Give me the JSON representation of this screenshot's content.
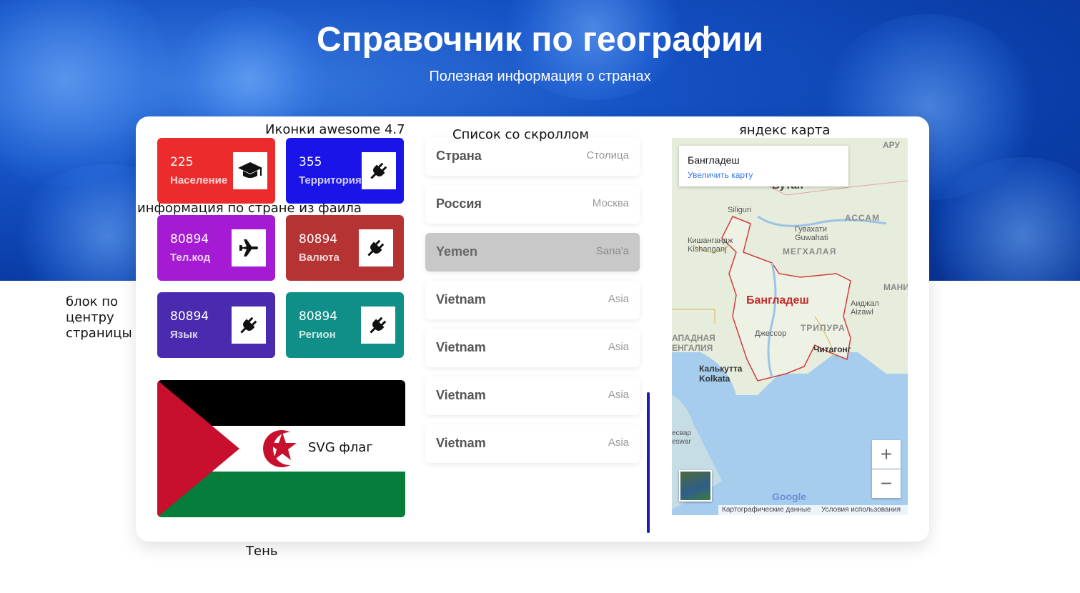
{
  "header": {
    "title": "Справочник по географии",
    "subtitle": "Полезная информация о странах"
  },
  "annotations": {
    "icons": "Иконки awesome 4.7",
    "list": "Список со скроллом",
    "map": "яндекс карта",
    "info": "информация по стране из фаила",
    "center_block": "блок по центру страницы",
    "shadow": "Тень",
    "svg_flag": "SVG флаг"
  },
  "tiles": [
    {
      "value": "225",
      "label": "Население",
      "color": "#ec2c2c",
      "icon": "graduation-cap-icon"
    },
    {
      "value": "355",
      "label": "Территория",
      "color": "#1a14e8",
      "icon": "plug-icon"
    },
    {
      "value": "80894",
      "label": "Тел.код",
      "color": "#a51bd4",
      "icon": "plane-icon"
    },
    {
      "value": "80894",
      "label": "Валюта",
      "color": "#b53333",
      "icon": "plug-icon"
    },
    {
      "value": "80894",
      "label": "Язык",
      "color": "#4a2bb0",
      "icon": "plug-icon"
    },
    {
      "value": "80894",
      "label": "Регион",
      "color": "#0f8f88",
      "icon": "plug-icon"
    }
  ],
  "flag": {
    "colors": {
      "black": "#000000",
      "white": "#ffffff",
      "green": "#067d3a",
      "red": "#c8102e"
    }
  },
  "country_list": [
    {
      "country": "Страна",
      "capital": "Столица"
    },
    {
      "country": "Россия",
      "capital": "Москва"
    },
    {
      "country": "Yemen",
      "capital": "Sana'a",
      "selected": true
    },
    {
      "country": "Vietnam",
      "capital": "Asia"
    },
    {
      "country": "Vietnam",
      "capital": "Asia"
    },
    {
      "country": "Vietnam",
      "capital": "Asia"
    },
    {
      "country": "Vietnam",
      "capital": "Asia"
    }
  ],
  "map": {
    "popup_title": "Бангладеш",
    "popup_link": "Увеличить карту",
    "zoom_in": "+",
    "zoom_out": "−",
    "labels": {
      "bangladesh": "Бангладеш",
      "bhutan": "Бутан",
      "assam": "АССАМ",
      "meghalaya": "МЕГХАЛАЯ",
      "tripura": "ТРИПУРА",
      "mani": "МАНИ",
      "aru": "АРУ",
      "siliguri": "Siliguri",
      "guwahati": "Гувахати Guwahati",
      "kishanganj": "Кишангандж Kishanganj",
      "jessore": "Джессор",
      "kolkata": "Калькутта Kolkata",
      "chittagong": "Читагонг",
      "aizawl": "Аиджал Aizawl",
      "west_bengal": "АПАДНАЯ ЕНГАЛИЯ",
      "eswar": "есвар eswar",
      "google": "Google",
      "map_data": "Картографические данные",
      "terms": "Условия использования"
    }
  }
}
